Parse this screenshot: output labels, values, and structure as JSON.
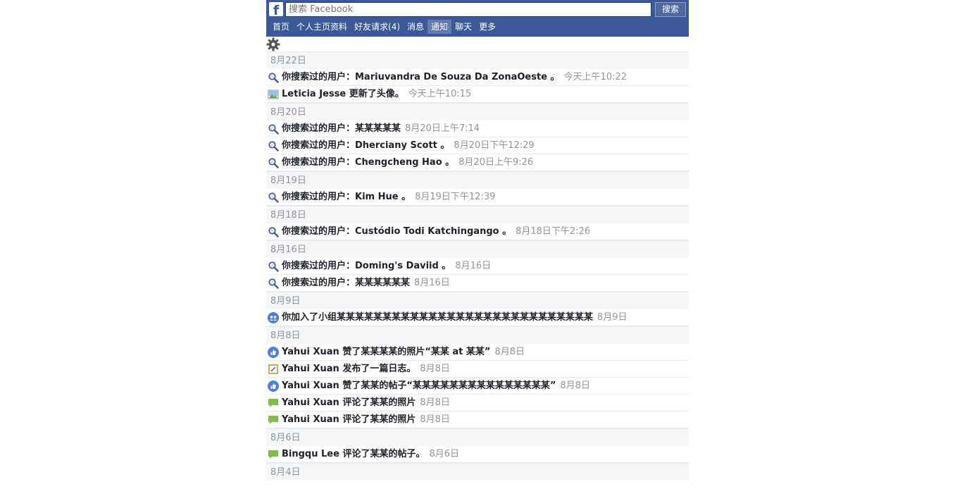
{
  "header": {
    "logo": "f",
    "search_placeholder": "搜索 Facebook",
    "search_button": "搜索",
    "nav": [
      {
        "label": "首页",
        "active": false
      },
      {
        "label": "个人主页资料",
        "active": false
      },
      {
        "label": "好友请求(4)",
        "active": false
      },
      {
        "label": "消息",
        "active": false
      },
      {
        "label": "通知",
        "active": true
      },
      {
        "label": "聊天",
        "active": false
      },
      {
        "label": "更多",
        "active": false
      }
    ]
  },
  "settings_icon": "gear-icon",
  "feed": [
    {
      "date": "8月22日",
      "items": [
        {
          "icon": "search-icon",
          "text": "你搜索过的用户：Mariuvandra De Souza Da ZonaOeste 。",
          "time": "今天上午10:22"
        },
        {
          "icon": "photo-icon",
          "text": "Leticia Jesse 更新了头像。",
          "time": "今天上午10:15"
        }
      ]
    },
    {
      "date": "8月20日",
      "items": [
        {
          "icon": "search-icon",
          "text": "你搜索过的用户：某某某某某",
          "time": "8月20日上午7:14"
        },
        {
          "icon": "search-icon",
          "text": "你搜索过的用户：Dherciany Scott 。",
          "time": "8月20日下午12:29"
        },
        {
          "icon": "search-icon",
          "text": "你搜索过的用户：Chengcheng Hao 。",
          "time": "8月20日上午9:26"
        }
      ]
    },
    {
      "date": "8月19日",
      "items": [
        {
          "icon": "search-icon",
          "text": "你搜索过的用户：Kim Hue 。",
          "time": "8月19日下午12:39"
        }
      ]
    },
    {
      "date": "8月18日",
      "items": [
        {
          "icon": "search-icon",
          "text": "你搜索过的用户：Custódio Todi Katchingango 。",
          "time": "8月18日下午2:26"
        }
      ]
    },
    {
      "date": "8月16日",
      "items": [
        {
          "icon": "search-icon",
          "text": "你搜索过的用户：Doming's Daviid 。",
          "time": "8月16日"
        },
        {
          "icon": "search-icon",
          "text": "你搜索过的用户：某某某某某某",
          "time": "8月16日"
        }
      ]
    },
    {
      "date": "8月9日",
      "items": [
        {
          "icon": "group-icon",
          "text": "你加入了小组某某某某某某某某某某某某某某某某某某某某某某某某某某某某",
          "time": "8月9日"
        }
      ]
    },
    {
      "date": "8月8日",
      "items": [
        {
          "icon": "like-icon",
          "text": "Yahui Xuan 赞了某某某某的照片“某某 at 某某”",
          "time": "8月8日"
        },
        {
          "icon": "note-icon",
          "text": "Yahui Xuan 发布了一篇日志。",
          "time": "8月8日"
        },
        {
          "icon": "like-icon",
          "text": "Yahui Xuan 赞了某某的帖子“某某某某某某某某某某某某某某某”",
          "time": "8月8日"
        },
        {
          "icon": "comment-icon",
          "text": "Yahui Xuan 评论了某某的照片",
          "time": "8月8日"
        },
        {
          "icon": "comment-icon",
          "text": "Yahui Xuan 评论了某某的照片",
          "time": "8月8日"
        }
      ]
    },
    {
      "date": "8月6日",
      "items": [
        {
          "icon": "comment-icon",
          "text": "Bingqu Lee 评论了某某的帖子。",
          "time": "8月6日"
        }
      ]
    },
    {
      "date": "8月4日",
      "items": []
    }
  ]
}
